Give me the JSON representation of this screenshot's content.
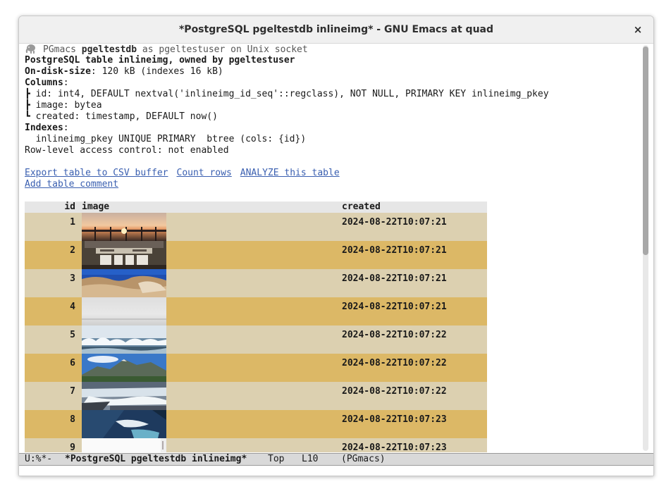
{
  "window": {
    "title": "*PostgreSQL pgeltestdb inlineimg* - GNU Emacs at quad",
    "close_glyph": "×"
  },
  "header_line": {
    "icon": "elephant-icon",
    "prefix": "PGmacs ",
    "database": "pgeltestdb",
    "middle": " as pgeltestuser on Unix socket"
  },
  "table_info": {
    "title": "PostgreSQL table inlineimg, owned by pgeltestuser",
    "disk_label": "On-disk-size",
    "disk_value": ": 120 kB (indexes 16 kB)",
    "columns_label": "Columns",
    "columns_suffix": ":",
    "columns": [
      "┣ id: int4, DEFAULT nextval('inlineimg_id_seq'::regclass), NOT NULL, PRIMARY KEY inlineimg_pkey",
      "┣ image: bytea",
      "┗ created: timestamp, DEFAULT now()"
    ],
    "indexes_label": "Indexes",
    "indexes_suffix": ":",
    "index_line": "  inlineimg_pkey UNIQUE PRIMARY  btree (cols: {id})",
    "rls_line": "Row-level access control: not enabled"
  },
  "actions": {
    "export_csv": "Export table to CSV buffer",
    "count_rows": "Count rows",
    "analyze": "ANALYZE this table",
    "add_comment": "Add table comment"
  },
  "table": {
    "headers": {
      "id": "id",
      "image": "image",
      "created": "created"
    },
    "rows": [
      {
        "id": "1",
        "created": "2024-08-22T10:07:21",
        "image": "sunset-pier-thumbnail"
      },
      {
        "id": "2",
        "created": "2024-08-22T10:07:21",
        "image": "mass-hall-building-thumbnail"
      },
      {
        "id": "3",
        "created": "2024-08-22T10:07:21",
        "image": "rock-formation-blue-sky-thumbnail"
      },
      {
        "id": "4",
        "created": "2024-08-22T10:07:21",
        "image": "foggy-grey-landscape-thumbnail"
      },
      {
        "id": "5",
        "created": "2024-08-22T10:07:22",
        "image": "splashing-waves-thumbnail"
      },
      {
        "id": "6",
        "created": "2024-08-22T10:07:22",
        "image": "mountain-sky-thumbnail"
      },
      {
        "id": "7",
        "created": "2024-08-22T10:07:22",
        "image": "waterfall-thumbnail"
      },
      {
        "id": "8",
        "created": "2024-08-22T10:07:23",
        "image": "river-aerial-thumbnail"
      },
      {
        "id": "9",
        "created": "2024-08-22T10:07:23",
        "image": "white-snow-thumbnail"
      }
    ]
  },
  "modeline": {
    "status": "U:%*-",
    "buffer_name": "*PostgreSQL pgeltestdb inlineimg*",
    "position": "Top",
    "line": "L10",
    "mode": "(PGmacs)"
  },
  "colors": {
    "row_odd": "#dcd0b0",
    "row_even": "#dcb866",
    "link": "#3a5fb0",
    "header_bg": "#e6e6e6"
  }
}
